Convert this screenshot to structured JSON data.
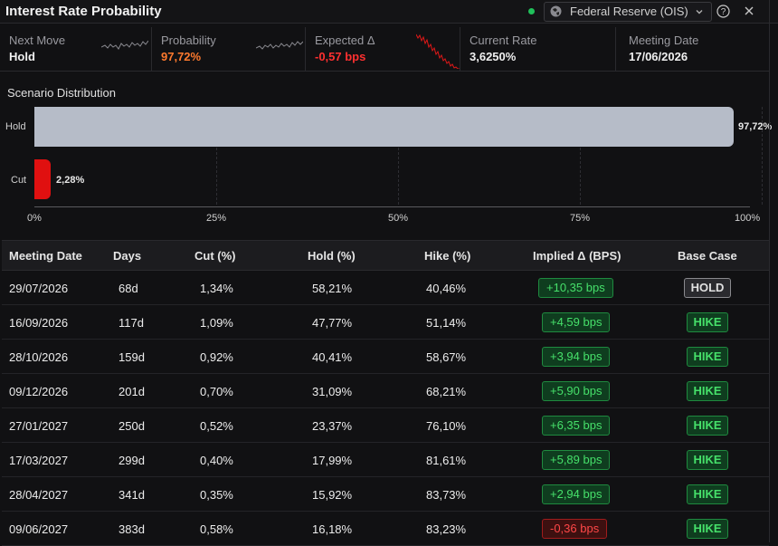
{
  "window": {
    "title": "Interest Rate Probability",
    "source": "Federal Reserve (OIS)",
    "status_color": "#20c05a"
  },
  "stats": [
    {
      "label": "Next Move",
      "value": "Hold"
    },
    {
      "label": "Probability",
      "value": "97,72%"
    },
    {
      "label": "Expected Δ",
      "value": "-0,57 bps"
    },
    {
      "label": "Current Rate",
      "value": "3,6250%"
    },
    {
      "label": "Meeting Date",
      "value": "17/06/2026"
    }
  ],
  "distribution": {
    "title": "Scenario Distribution",
    "bars": [
      {
        "label": "Hold",
        "value": 97.72,
        "display": "97,72%",
        "color": "#b6bcc8"
      },
      {
        "label": "Cut",
        "value": 2.28,
        "display": "2,28%",
        "color": "#e01010"
      }
    ],
    "axis_ticks": [
      "0%",
      "25%",
      "50%",
      "75%",
      "100%"
    ]
  },
  "table": {
    "headers": [
      "Meeting Date",
      "Days",
      "Cut (%)",
      "Hold (%)",
      "Hike (%)",
      "Implied Δ (BPS)",
      "Base Case"
    ],
    "rows": [
      {
        "date": "29/07/2026",
        "days": "68d",
        "cut": "1,34%",
        "hold": "58,21%",
        "hike": "40,46%",
        "implied": "+10,35 bps",
        "sign": "pos",
        "base": "HOLD"
      },
      {
        "date": "16/09/2026",
        "days": "117d",
        "cut": "1,09%",
        "hold": "47,77%",
        "hike": "51,14%",
        "implied": "+4,59 bps",
        "sign": "pos",
        "base": "HIKE"
      },
      {
        "date": "28/10/2026",
        "days": "159d",
        "cut": "0,92%",
        "hold": "40,41%",
        "hike": "58,67%",
        "implied": "+3,94 bps",
        "sign": "pos",
        "base": "HIKE"
      },
      {
        "date": "09/12/2026",
        "days": "201d",
        "cut": "0,70%",
        "hold": "31,09%",
        "hike": "68,21%",
        "implied": "+5,90 bps",
        "sign": "pos",
        "base": "HIKE"
      },
      {
        "date": "27/01/2027",
        "days": "250d",
        "cut": "0,52%",
        "hold": "23,37%",
        "hike": "76,10%",
        "implied": "+6,35 bps",
        "sign": "pos",
        "base": "HIKE"
      },
      {
        "date": "17/03/2027",
        "days": "299d",
        "cut": "0,40%",
        "hold": "17,99%",
        "hike": "81,61%",
        "implied": "+5,89 bps",
        "sign": "pos",
        "base": "HIKE"
      },
      {
        "date": "28/04/2027",
        "days": "341d",
        "cut": "0,35%",
        "hold": "15,92%",
        "hike": "83,73%",
        "implied": "+2,94 bps",
        "sign": "pos",
        "base": "HIKE"
      },
      {
        "date": "09/06/2027",
        "days": "383d",
        "cut": "0,58%",
        "hold": "16,18%",
        "hike": "83,23%",
        "implied": "-0,36 bps",
        "sign": "neg",
        "base": "HIKE"
      }
    ]
  }
}
